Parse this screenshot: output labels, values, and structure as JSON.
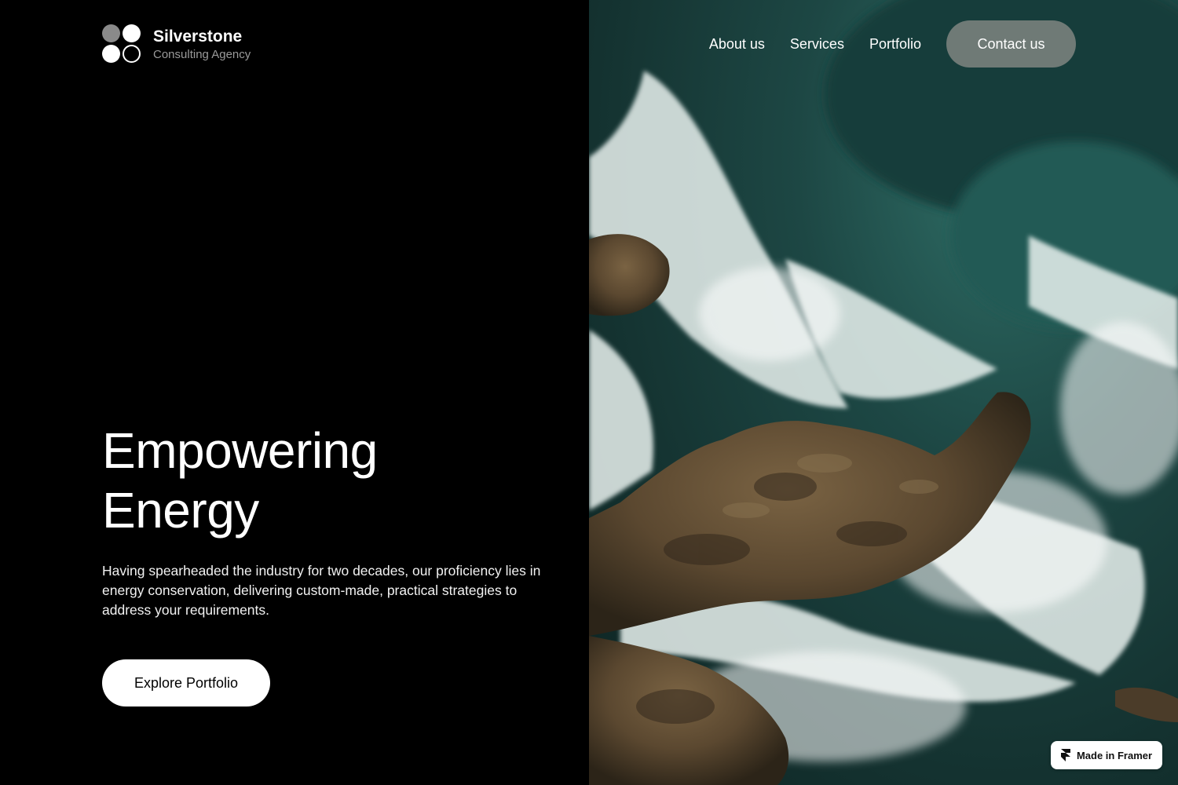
{
  "brand": {
    "name": "Silverstone",
    "tagline": "Consulting Agency"
  },
  "nav": {
    "items": [
      {
        "label": "About us"
      },
      {
        "label": "Services"
      },
      {
        "label": "Portfolio"
      }
    ],
    "cta_label": "Contact us"
  },
  "hero": {
    "title_lines": [
      "Empowering",
      "Energy"
    ],
    "description": "Having spearheaded the industry for two decades, our proficiency lies in energy conservation, delivering custom-made, practical strategies to address your requirements.",
    "cta_label": "Explore Portfolio"
  },
  "badge": {
    "label": "Made in Framer",
    "icon": "framer-logo-icon"
  },
  "colors": {
    "background": "#000000",
    "ocean": "#1d4744",
    "foam": "#e9f2ef",
    "rock": "#5e4a30",
    "contact_button": "#828784"
  }
}
